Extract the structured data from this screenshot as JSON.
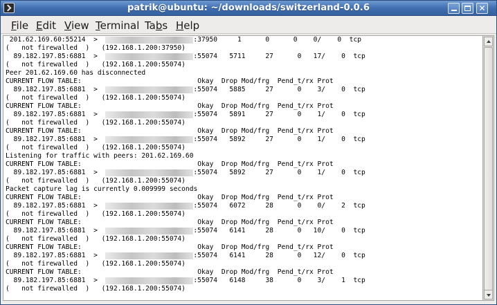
{
  "window": {
    "title": "patrik@ubuntu: ~/downloads/switzerland-0.0.6"
  },
  "menubar": [
    {
      "label": "File",
      "mnemonic": "F"
    },
    {
      "label": "Edit",
      "mnemonic": "E"
    },
    {
      "label": "View",
      "mnemonic": "V"
    },
    {
      "label": "Terminal",
      "mnemonic": "T"
    },
    {
      "label": "Tabs",
      "mnemonic": "b"
    },
    {
      "label": "Help",
      "mnemonic": "H"
    }
  ],
  "terminal": {
    "lines": [
      [
        " 201.62.169.60:55214  >  ",
        null,
        ":37950     1      0      0    0/    0  tcp"
      ],
      [
        "(   not firewalled  )   (192.168.1.200:37950)"
      ],
      [
        "  89.182.197.85:6881  >  ",
        null,
        ":55074   5711     27      0   17/    0  tcp"
      ],
      [
        "(   not firewalled  )   (192.168.1.200:55074)"
      ],
      [
        "Peer 201.62.169.60 has disconnected"
      ],
      [
        "CURRENT FLOW TABLE:                             Okay  Drop Mod/frg  Pend_t/rx Prot"
      ],
      [
        "  89.182.197.85:6881  >  ",
        null,
        ":55074   5885     27      0    3/    0  tcp"
      ],
      [
        "(   not firewalled  )   (192.168.1.200:55074)"
      ],
      [
        "CURRENT FLOW TABLE:                             Okay  Drop Mod/frg  Pend_t/rx Prot"
      ],
      [
        "  89.182.197.85:6881  >  ",
        null,
        ":55074   5891     27      0    1/    0  tcp"
      ],
      [
        "(   not firewalled  )   (192.168.1.200:55074)"
      ],
      [
        "CURRENT FLOW TABLE:                             Okay  Drop Mod/frg  Pend_t/rx Prot"
      ],
      [
        "  89.182.197.85:6881  >  ",
        null,
        ":55074   5892     27      0    1/    0  tcp"
      ],
      [
        "(   not firewalled  )   (192.168.1.200:55074)"
      ],
      [
        "Listening for traffic with peers: 201.62.169.60"
      ],
      [
        "CURRENT FLOW TABLE:                             Okay  Drop Mod/frg  Pend_t/rx Prot"
      ],
      [
        "  89.182.197.85:6881  >  ",
        null,
        ":55074   5892     27      0    1/    0  tcp"
      ],
      [
        "(   not firewalled  )   (192.168.1.200:55074)"
      ],
      [
        "Packet capture lag is currently 0.009999 seconds"
      ],
      [
        "CURRENT FLOW TABLE:                             Okay  Drop Mod/frg  Pend_t/rx Prot"
      ],
      [
        "  89.182.197.85:6881  >  ",
        null,
        ":55074   6072     28      0    0/    2  tcp"
      ],
      [
        "(   not firewalled  )   (192.168.1.200:55074)"
      ],
      [
        "CURRENT FLOW TABLE:                             Okay  Drop Mod/frg  Pend_t/rx Prot"
      ],
      [
        "  89.182.197.85:6881  >  ",
        null,
        ":55074   6141     28      0   10/    0  tcp"
      ],
      [
        "(   not firewalled  )   (192.168.1.200:55074)"
      ],
      [
        "CURRENT FLOW TABLE:                             Okay  Drop Mod/frg  Pend_t/rx Prot"
      ],
      [
        "  89.182.197.85:6881  >  ",
        null,
        ":55074   6141     28      0   12/    0  tcp"
      ],
      [
        "(   not firewalled  )   (192.168.1.200:55074)"
      ],
      [
        "CURRENT FLOW TABLE:                             Okay  Drop Mod/frg  Pend_t/rx Prot"
      ],
      [
        "  89.182.197.85:6881  >  ",
        null,
        ":55074   6148     38      0    3/    1  tcp"
      ],
      [
        "(   not firewalled  )   (192.168.1.200:55074)"
      ]
    ]
  },
  "icons": {
    "window_icon": "terminal-icon",
    "minimize": "minimize-icon",
    "maximize": "maximize-icon",
    "close": "close-icon"
  },
  "colors": {
    "titlebar": "#3e6cae",
    "terminal_bg": "#ffffff",
    "terminal_fg": "#000000"
  }
}
